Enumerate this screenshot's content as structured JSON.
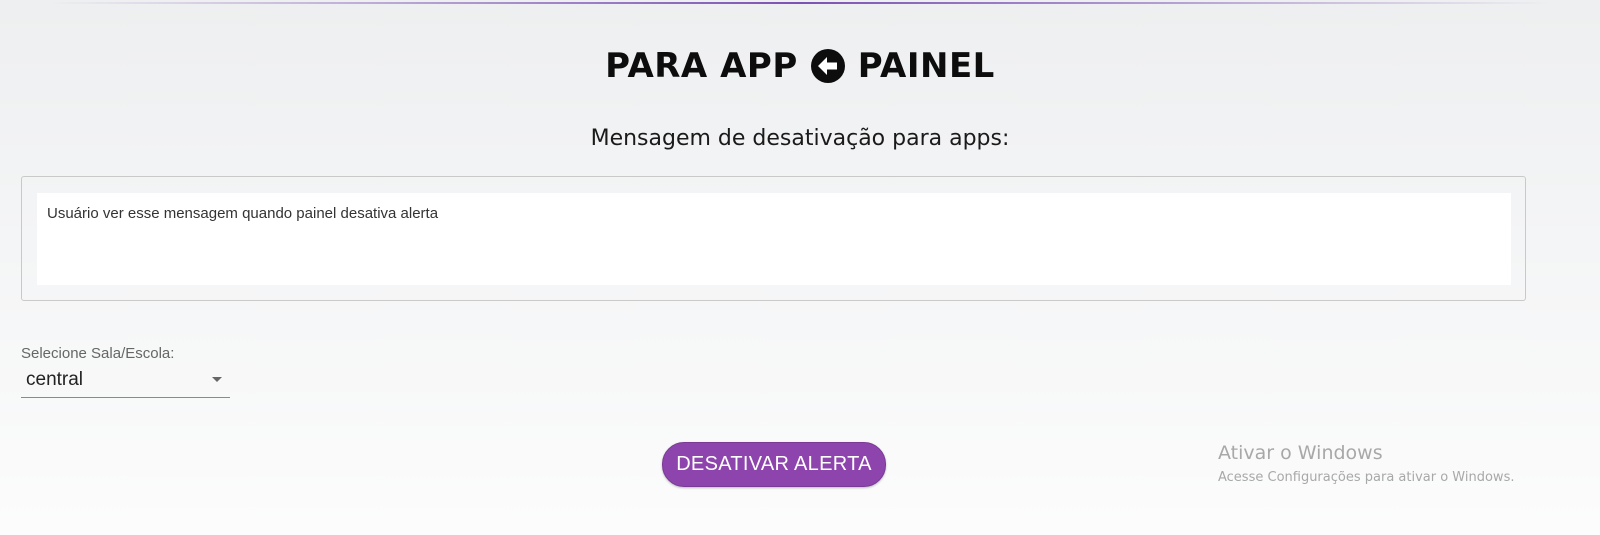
{
  "header": {
    "title_left": "PARA APP",
    "title_right": "PAINEL",
    "arrow_icon": "arrow-left-circle-icon"
  },
  "subtitle": "Mensagem de desativação para apps:",
  "message": {
    "value": "Usuário ver esse mensagem quando painel desativa alerta"
  },
  "select": {
    "label": "Selecione Sala/Escola:",
    "value": "central",
    "caret_icon": "caret-down-icon"
  },
  "button": {
    "label": "DESATIVAR ALERTA",
    "color": "#8e44ad"
  },
  "watermark": {
    "title": "Ativar o Windows",
    "subtitle": "Acesse Configurações para ativar o Windows."
  }
}
